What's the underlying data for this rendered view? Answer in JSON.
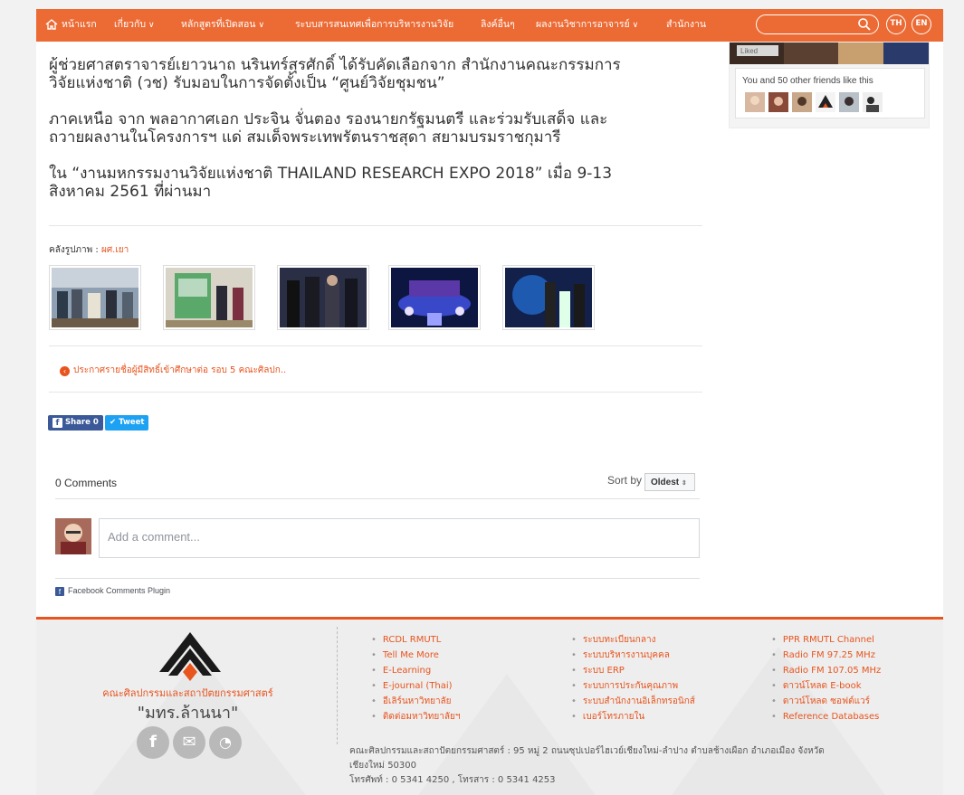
{
  "nav": {
    "items": [
      {
        "label": "หน้าแรก",
        "has_dropdown": false,
        "icon": "home-icon"
      },
      {
        "label": "เกี่ยวกับ",
        "has_dropdown": true
      },
      {
        "label": "หลักสูตรที่เปิดสอน",
        "has_dropdown": true
      },
      {
        "label": "ระบบสารสนเทศเพื่อการบริหารงานวิจัย",
        "has_dropdown": false
      },
      {
        "label": "ลิงค์อื่นๆ",
        "has_dropdown": false
      },
      {
        "label": "ผลงานวิชาการอาจารย์",
        "has_dropdown": true
      },
      {
        "label": "สำนักงาน",
        "has_dropdown": false
      }
    ],
    "search_value": "",
    "lang_th": "TH",
    "lang_en": "EN",
    "color": "#ec6b35"
  },
  "article": {
    "paragraphs": [
      {
        "lines": [
          "ผู้ช่วยศาสตราจารย์เยาวนาถ นรินทร์สุรศักดิ์ ได้รับคัดเลือกจาก สำนักงานคณะกรรมการ",
          "วิจัยแห่งชาติ (วช) รับมอบในการจัดตั้งเป็น “ศูนย์วิจัยชุมชน”"
        ]
      },
      {
        "lines": [
          "ภาคเหนือ จาก พลอากาศเอก ประจิน จั่นตอง รองนายกรัฐมนตรี และร่วมรับเสด็จ และ",
          "ถวายผลงานในโครงการฯ แด่ สมเด็จพระเทพรัตนราชสุดา สยามบรมราชกุมารี"
        ]
      },
      {
        "lines": [
          "ใน “งานมหกรรมงานวิจัยแห่งชาติ THAILAND RESEARCH EXPO 2018” เมื่อ 9-13",
          "สิงหาคม 2561 ที่ผ่านมา"
        ]
      }
    ]
  },
  "gallery": {
    "label": "คลังรูปภาพ : ",
    "link": "ผศ.เยา",
    "thumbnails": [
      "photo-1",
      "photo-2",
      "photo-3",
      "photo-4",
      "photo-5"
    ]
  },
  "prev_post": {
    "label": "ประกาศรายชื่อผู้มีสิทธิ์เข้าศึกษาต่อ รอบ 5 คณะศิลปก.."
  },
  "share": {
    "facebook_label": "Share 0",
    "twitter_label": "Tweet",
    "facebook_color": "#3b5998",
    "twitter_color": "#1da1f2"
  },
  "comments": {
    "count_label": "0 Comments",
    "sort_label": "Sort by",
    "sort_value": "Oldest",
    "input_placeholder": "Add a comment...",
    "plugin_label": "Facebook Comments Plugin"
  },
  "widget": {
    "liked_label": "Liked",
    "friends_text": "You and 50 other friends like this"
  },
  "footer": {
    "accent": "#e8541e",
    "faculty_name": "คณะศิลปกรรมและสถาปัตยกรรมศาสตร์",
    "university_name": "\"มทร.ล้านนา\"",
    "social_icons": [
      "facebook-icon",
      "mail-icon",
      "rss-icon"
    ],
    "col1": [
      "RCDL RMUTL",
      "Tell Me More",
      "E-Learning",
      "E-journal (Thai)",
      "อีเลิร์นหาวิทยาลัย",
      "ติดต่อมหาวิทยาลัยฯ"
    ],
    "col2": [
      "ระบบทะเบียนกลาง",
      "ระบบบริหารงานบุคคล",
      "ระบบ ERP",
      "ระบบการประกันคุณภาพ",
      "ระบบสำนักงานอิเล็กทรอนิกส์",
      "เบอร์โทรภายใน"
    ],
    "col3": [
      "PPR RMUTL Channel",
      "Radio FM 97.25 MHz",
      "Radio FM 107.05 MHz",
      "ดาวน์โหลด E-book",
      "ดาวน์โหลด ซอฟต์แวร์",
      "Reference Databases"
    ],
    "address_line1": "คณะศิลปกรรมและสถาปัตยกรรมศาสตร์ : 95 หมู่ 2 ถนนซุปเปอร์ไฮเวย์เชียงใหม่-ลำปาง ตำบลช้างเผือก อำเภอเมือง จังหวัด",
    "address_line2": "เชียงใหม่ 50300",
    "phone_line": "โทรศัพท์ : 0 5341 4250 , โทรสาร : 0 5341 4253"
  }
}
